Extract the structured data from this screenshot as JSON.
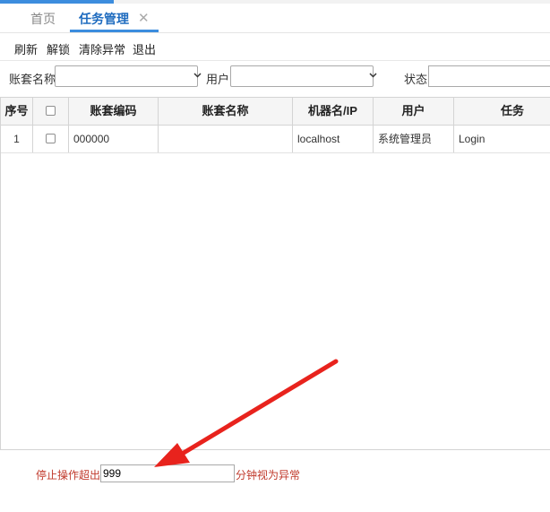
{
  "tabs": {
    "home": "首页",
    "task": "任务管理",
    "close": "✕"
  },
  "toolbar": {
    "refresh": "刷新",
    "unlock": "解锁",
    "clear_exception": "清除异常",
    "exit": "退出"
  },
  "filters": {
    "account_label": "账套名称",
    "account_value": "",
    "user_label": "用户",
    "user_value": "",
    "status_label": "状态",
    "status_value": ""
  },
  "table": {
    "columns": {
      "index": "序号",
      "code": "账套编码",
      "name": "账套名称",
      "machine": "机器名/IP",
      "user": "用户",
      "task": "任务"
    },
    "rows": [
      {
        "index": "1",
        "code": "000000",
        "name": "",
        "machine": "localhost",
        "user": "系统管理员",
        "task": "Login"
      }
    ]
  },
  "footer": {
    "prefix": "停止操作超出",
    "minutes": "999",
    "suffix": "分钟视为异常"
  },
  "colors": {
    "accent": "#3c8dde",
    "annotation_arrow": "#e8231d",
    "footer_text": "#c0392b"
  }
}
